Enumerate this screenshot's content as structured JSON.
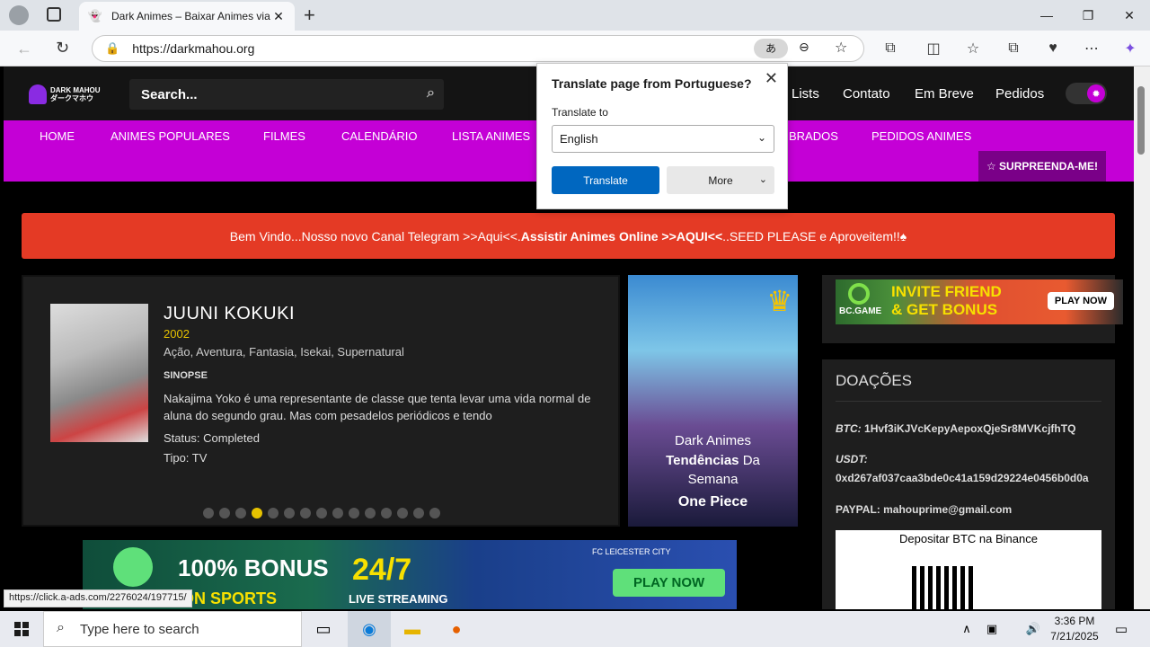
{
  "browser": {
    "tab_title": "Dark Animes – Baixar Animes via T",
    "url": "https://darkmahou.org"
  },
  "site": {
    "logo_line1": "DARK MAHOU",
    "logo_line2": "ダークマホウ",
    "search_placeholder": "Search...",
    "top_links": [
      "Lists",
      "Contato",
      "Em Breve",
      "Pedidos"
    ],
    "menu": [
      "HOME",
      "ANIMES POPULARES",
      "FILMES",
      "CALENDÁRIO",
      "LISTA ANIMES",
      "BRADOS",
      "PEDIDOS ANIMES"
    ],
    "surpreenda": "☆ SURPREENDA-ME!",
    "banner_text": "Bem Vindo...Nosso novo Canal Telegram >>Aqui<<.",
    "banner_bold": "Assistir Animes Online >>AQUI<<",
    "banner_tail": " ..SEED PLEASE e Aproveitem!!♠"
  },
  "featured": {
    "title": "JUUNI KOKUKI",
    "year": "2002",
    "genres": "Ação, Aventura, Fantasia, Isekai, Supernatural",
    "sinopse_label": "SINOPSE",
    "sinopse": "Nakajima Yoko é uma representante de classe que tenta levar uma vida normal de aluna do segundo grau. Mas com pesadelos periódicos e tendo",
    "status": "Status: Completed",
    "tipo": "Tipo: TV",
    "dots_total": 15,
    "dots_active_index": 3
  },
  "trending": {
    "line1": "Dark Animes",
    "line2a": "Tendências",
    "line2b": " Da",
    "line3": "Semana",
    "line4": "One Piece"
  },
  "side_ad": {
    "l1": "INVITE FRIEND",
    "l2": "& GET BONUS",
    "brand": "BC.GAME",
    "play": "PLAY NOW"
  },
  "doacoes": {
    "title": "DOAÇÕES",
    "btc_label": "BTC:",
    "btc": "1Hvf3iKJVcKepyAepoxQjeSr8MVKcjfhTQ",
    "usdt_label": "USDT:",
    "usdt": "0xd267af037caa3bde0c41a159d29224e0456b0d0a",
    "paypal": "PAYPAL: mahouprime@gmail.com",
    "qr_caption": "Depositar BTC na Binance"
  },
  "bottom_ad": {
    "bonus": "100% BONUS",
    "hours": "24/7",
    "live": "LIVE STREAMING",
    "club": "FC LEICESTER CITY",
    "play": "PLAY NOW",
    "sports": "ON SPORTS"
  },
  "status_link": "https://click.a-ads.com/2276024/197715/",
  "translate": {
    "title": "Translate page from Portuguese?",
    "label": "Translate to",
    "language": "English",
    "translate_btn": "Translate",
    "more_btn": "More"
  },
  "taskbar": {
    "search_placeholder": "Type here to search",
    "time": "3:36 PM",
    "date": "7/21/2025"
  }
}
